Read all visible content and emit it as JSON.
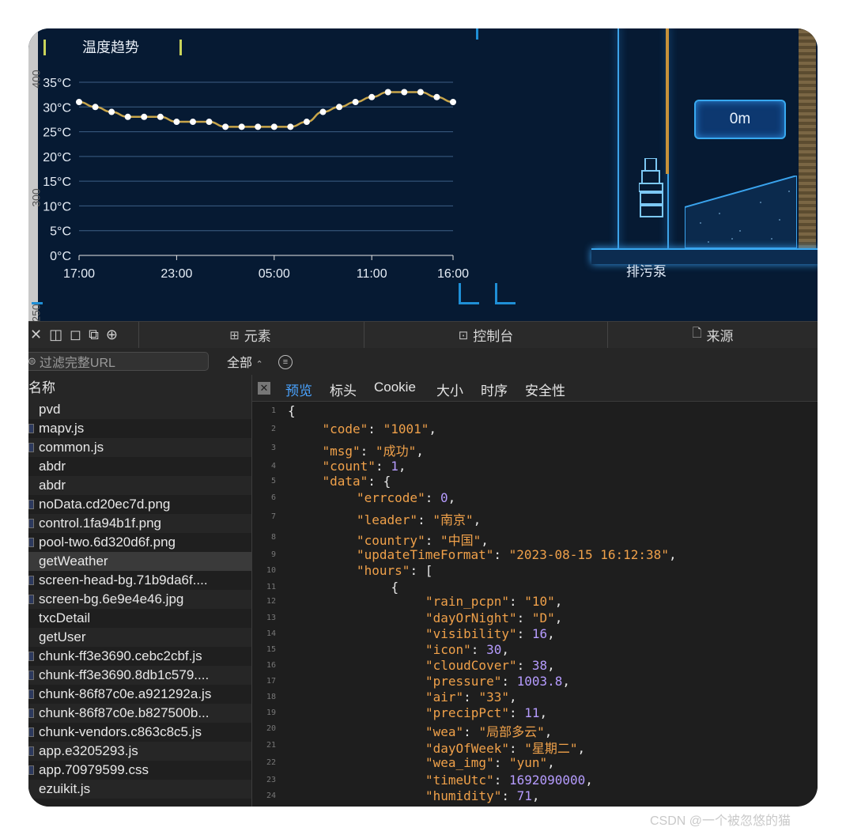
{
  "chart": {
    "title": "温度趋势",
    "left_bar_labels": [
      "400",
      "300",
      "250"
    ]
  },
  "chart_data": {
    "type": "line",
    "title": "温度趋势",
    "xlabel": "",
    "ylabel": "",
    "ylim": [
      0,
      35
    ],
    "yticks": [
      "35°C",
      "30°C",
      "25°C",
      "20°C",
      "15°C",
      "10°C",
      "5°C",
      "0°C"
    ],
    "x_tick_labels": [
      "17:00",
      "23:00",
      "05:00",
      "11:00",
      "16:00"
    ],
    "x_tick_index": [
      0,
      6,
      12,
      18,
      23
    ],
    "series": [
      {
        "values": [
          31,
          30,
          29,
          28,
          28,
          28,
          27,
          27,
          27,
          26,
          26,
          26,
          26,
          26,
          27,
          29,
          30,
          31,
          32,
          33,
          33,
          33,
          32,
          31
        ]
      }
    ],
    "line_color": "#c8a54a",
    "grid": true,
    "legend": "none"
  },
  "scene": {
    "level_value": "0m",
    "pump_label": "排污泵"
  },
  "devtools": {
    "toolbar_icons": [
      "close-icon",
      "dock-icon",
      "inspect-element-icon",
      "device-icon",
      "target-icon"
    ],
    "tabs": [
      {
        "label": "元素",
        "icon": "elements-icon"
      },
      {
        "label": "控制台",
        "icon": "console-icon"
      },
      {
        "label": "来源",
        "icon": "sources-icon"
      }
    ],
    "filter_placeholder": "过滤完整URL",
    "filter_select": "全部",
    "list_header": "名称",
    "requests": [
      "pvd",
      "mapv.js",
      "common.js",
      "abdr",
      "abdr",
      "noData.cd20ec7d.png",
      "control.1fa94b1f.png",
      "pool-two.6d320d6f.png",
      "getWeather",
      "screen-head-bg.71b9da6f....",
      "screen-bg.6e9e4e46.jpg",
      "txcDetail",
      "getUser",
      "chunk-ff3e3690.cebc2cbf.js",
      "chunk-ff3e3690.8db1c579....",
      "chunk-86f87c0e.a921292a.js",
      "chunk-86f87c0e.b827500b...",
      "chunk-vendors.c863c8c5.js",
      "app.e3205293.js",
      "app.70979599.css",
      "ezuikit.js"
    ],
    "selected_request": "getWeather",
    "preview_tabs": [
      "预览",
      "标头",
      "Cookie",
      "大小",
      "时序",
      "安全性"
    ],
    "active_preview_tab": "预览",
    "code_lines": [
      {
        "n": "1",
        "indent": 0,
        "parts": [
          [
            "p",
            "{"
          ]
        ]
      },
      {
        "n": "2",
        "indent": 1,
        "parts": [
          [
            "k",
            "\"code\""
          ],
          [
            "p",
            ": "
          ],
          [
            "s",
            "\"1001\""
          ],
          [
            "p",
            ","
          ]
        ]
      },
      {
        "n": "3",
        "indent": 1,
        "parts": [
          [
            "k",
            "\"msg\""
          ],
          [
            "p",
            ": "
          ],
          [
            "s",
            "\"成功\""
          ],
          [
            "p",
            ","
          ]
        ]
      },
      {
        "n": "4",
        "indent": 1,
        "parts": [
          [
            "k",
            "\"count\""
          ],
          [
            "p",
            ": "
          ],
          [
            "n",
            "1"
          ],
          [
            "p",
            ","
          ]
        ]
      },
      {
        "n": "5",
        "indent": 1,
        "parts": [
          [
            "k",
            "\"data\""
          ],
          [
            "p",
            ": {"
          ]
        ]
      },
      {
        "n": "6",
        "indent": 2,
        "parts": [
          [
            "k",
            "\"errcode\""
          ],
          [
            "p",
            ": "
          ],
          [
            "n",
            "0"
          ],
          [
            "p",
            ","
          ]
        ]
      },
      {
        "n": "7",
        "indent": 2,
        "parts": [
          [
            "k",
            "\"leader\""
          ],
          [
            "p",
            ": "
          ],
          [
            "s",
            "\"南京\""
          ],
          [
            "p",
            ","
          ]
        ]
      },
      {
        "n": "8",
        "indent": 2,
        "parts": [
          [
            "k",
            "\"country\""
          ],
          [
            "p",
            ": "
          ],
          [
            "s",
            "\"中国\""
          ],
          [
            "p",
            ","
          ]
        ]
      },
      {
        "n": "9",
        "indent": 2,
        "parts": [
          [
            "k",
            "\"updateTimeFormat\""
          ],
          [
            "p",
            ": "
          ],
          [
            "s",
            "\"2023-08-15 16:12:38\""
          ],
          [
            "p",
            ","
          ]
        ]
      },
      {
        "n": "10",
        "indent": 2,
        "parts": [
          [
            "k",
            "\"hours\""
          ],
          [
            "p",
            ": ["
          ]
        ]
      },
      {
        "n": "11",
        "indent": 3,
        "parts": [
          [
            "p",
            "{"
          ]
        ]
      },
      {
        "n": "12",
        "indent": 4,
        "parts": [
          [
            "k",
            "\"rain_pcpn\""
          ],
          [
            "p",
            ": "
          ],
          [
            "s",
            "\"10\""
          ],
          [
            "p",
            ","
          ]
        ]
      },
      {
        "n": "13",
        "indent": 4,
        "parts": [
          [
            "k",
            "\"dayOrNight\""
          ],
          [
            "p",
            ": "
          ],
          [
            "s",
            "\"D\""
          ],
          [
            "p",
            ","
          ]
        ]
      },
      {
        "n": "14",
        "indent": 4,
        "parts": [
          [
            "k",
            "\"visibility\""
          ],
          [
            "p",
            ": "
          ],
          [
            "n",
            "16"
          ],
          [
            "p",
            ","
          ]
        ]
      },
      {
        "n": "15",
        "indent": 4,
        "parts": [
          [
            "k",
            "\"icon\""
          ],
          [
            "p",
            ": "
          ],
          [
            "n",
            "30"
          ],
          [
            "p",
            ","
          ]
        ]
      },
      {
        "n": "16",
        "indent": 4,
        "parts": [
          [
            "k",
            "\"cloudCover\""
          ],
          [
            "p",
            ": "
          ],
          [
            "n",
            "38"
          ],
          [
            "p",
            ","
          ]
        ]
      },
      {
        "n": "17",
        "indent": 4,
        "parts": [
          [
            "k",
            "\"pressure\""
          ],
          [
            "p",
            ": "
          ],
          [
            "n",
            "1003.8"
          ],
          [
            "p",
            ","
          ]
        ]
      },
      {
        "n": "18",
        "indent": 4,
        "parts": [
          [
            "k",
            "\"air\""
          ],
          [
            "p",
            ": "
          ],
          [
            "s",
            "\"33\""
          ],
          [
            "p",
            ","
          ]
        ]
      },
      {
        "n": "19",
        "indent": 4,
        "parts": [
          [
            "k",
            "\"precipPct\""
          ],
          [
            "p",
            ": "
          ],
          [
            "n",
            "11"
          ],
          [
            "p",
            ","
          ]
        ]
      },
      {
        "n": "20",
        "indent": 4,
        "parts": [
          [
            "k",
            "\"wea\""
          ],
          [
            "p",
            ": "
          ],
          [
            "s",
            "\"局部多云\""
          ],
          [
            "p",
            ","
          ]
        ]
      },
      {
        "n": "21",
        "indent": 4,
        "parts": [
          [
            "k",
            "\"dayOfWeek\""
          ],
          [
            "p",
            ": "
          ],
          [
            "s",
            "\"星期二\""
          ],
          [
            "p",
            ","
          ]
        ]
      },
      {
        "n": "22",
        "indent": 4,
        "parts": [
          [
            "k",
            "\"wea_img\""
          ],
          [
            "p",
            ": "
          ],
          [
            "s",
            "\"yun\""
          ],
          [
            "p",
            ","
          ]
        ]
      },
      {
        "n": "23",
        "indent": 4,
        "parts": [
          [
            "k",
            "\"timeUtc\""
          ],
          [
            "p",
            ": "
          ],
          [
            "n",
            "1692090000"
          ],
          [
            "p",
            ","
          ]
        ]
      },
      {
        "n": "24",
        "indent": 4,
        "parts": [
          [
            "k",
            "\"humidity\""
          ],
          [
            "p",
            ": "
          ],
          [
            "n",
            "71"
          ],
          [
            "p",
            ","
          ]
        ]
      }
    ]
  },
  "watermark": "CSDN @一个被忽悠的猫",
  "colors": {
    "screen_bg": "#061a33",
    "accent_blue": "#3ea3e8",
    "devtools_bg": "#1e1e1e",
    "json_key": "#f0a14a",
    "json_number": "#b69cff",
    "active_tab": "#4aa3ff"
  }
}
